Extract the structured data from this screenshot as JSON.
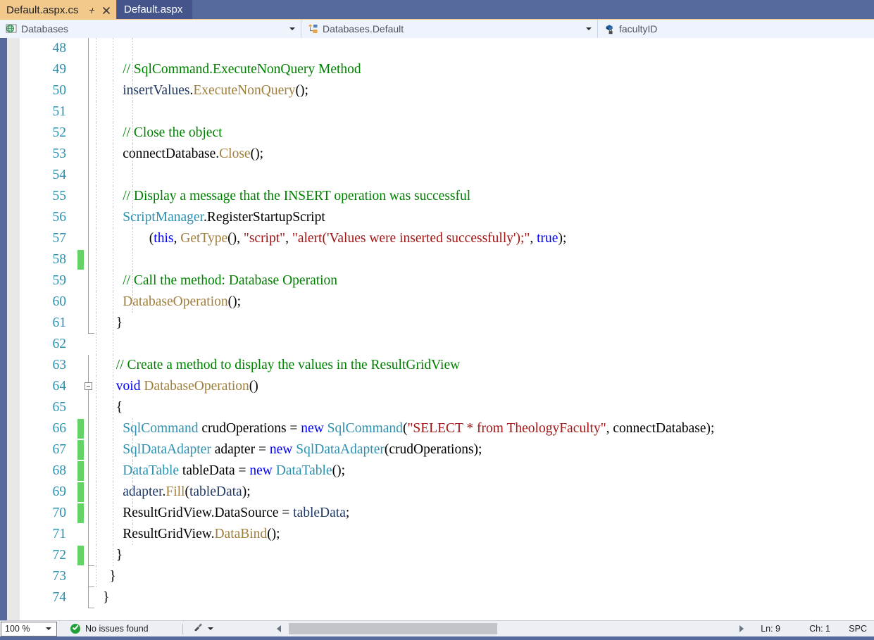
{
  "window": {
    "chrome_color": "#56699c",
    "editor_background": "#ffffff"
  },
  "tabs": [
    {
      "label": "Default.aspx.cs",
      "active": true,
      "pin_icon": "pin-icon",
      "close_icon": "close-icon"
    },
    {
      "label": "Default.aspx",
      "active": false
    }
  ],
  "navbar": {
    "project_dropdown": {
      "icon": "web-page-icon",
      "value": "Databases"
    },
    "type_dropdown": {
      "icon": "class-icon",
      "value": "Databases.Default"
    },
    "member_dropdown": {
      "icon": "private-field-icon",
      "value": "facultyID"
    }
  },
  "editor": {
    "first_line": 48,
    "lines": [
      {
        "n": 48,
        "indent": 0,
        "changed": false,
        "tokens": []
      },
      {
        "n": 49,
        "indent": 3,
        "changed": false,
        "tokens": [
          {
            "t": "// SqlCommand.ExecuteNonQuery Method",
            "c": "t-cmt"
          }
        ]
      },
      {
        "n": 50,
        "indent": 3,
        "changed": false,
        "tokens": [
          {
            "t": "insertValues",
            "c": "t-var"
          },
          {
            "t": ".",
            "c": "t-pln"
          },
          {
            "t": "ExecuteNonQuery",
            "c": "t-mth"
          },
          {
            "t": "();",
            "c": "t-pln"
          }
        ]
      },
      {
        "n": 51,
        "indent": 0,
        "changed": false,
        "tokens": []
      },
      {
        "n": 52,
        "indent": 3,
        "changed": false,
        "tokens": [
          {
            "t": "// Close the object",
            "c": "t-cmt"
          }
        ]
      },
      {
        "n": 53,
        "indent": 3,
        "changed": false,
        "tokens": [
          {
            "t": "connectDatabase",
            "c": "t-pln"
          },
          {
            "t": ".",
            "c": "t-pln"
          },
          {
            "t": "Close",
            "c": "t-mth"
          },
          {
            "t": "();",
            "c": "t-pln"
          }
        ]
      },
      {
        "n": 54,
        "indent": 0,
        "changed": false,
        "tokens": []
      },
      {
        "n": 55,
        "indent": 3,
        "changed": false,
        "tokens": [
          {
            "t": "// Display a message that the INSERT operation was successful",
            "c": "t-cmt"
          }
        ]
      },
      {
        "n": 56,
        "indent": 3,
        "changed": false,
        "tokens": [
          {
            "t": "ScriptManager",
            "c": "t-typ"
          },
          {
            "t": ".RegisterStartupScript",
            "c": "t-pln"
          }
        ]
      },
      {
        "n": 57,
        "indent": 7,
        "changed": false,
        "tokens": [
          {
            "t": "(",
            "c": "t-pln"
          },
          {
            "t": "this",
            "c": "t-kw"
          },
          {
            "t": ", ",
            "c": "t-pln"
          },
          {
            "t": "GetType",
            "c": "t-mth"
          },
          {
            "t": "(), ",
            "c": "t-pln"
          },
          {
            "t": "\"script\"",
            "c": "t-str"
          },
          {
            "t": ", ",
            "c": "t-pln"
          },
          {
            "t": "\"alert('Values were inserted successfully');\"",
            "c": "t-str"
          },
          {
            "t": ", ",
            "c": "t-pln"
          },
          {
            "t": "true",
            "c": "t-kw"
          },
          {
            "t": ");",
            "c": "t-pln"
          }
        ]
      },
      {
        "n": 58,
        "indent": 0,
        "changed": true,
        "tokens": []
      },
      {
        "n": 59,
        "indent": 3,
        "changed": false,
        "tokens": [
          {
            "t": "// Call the method: Database Operation",
            "c": "t-cmt"
          }
        ]
      },
      {
        "n": 60,
        "indent": 3,
        "changed": false,
        "tokens": [
          {
            "t": "DatabaseOperation",
            "c": "t-mth"
          },
          {
            "t": "();",
            "c": "t-pln"
          }
        ]
      },
      {
        "n": 61,
        "indent": 2,
        "changed": false,
        "tokens": [
          {
            "t": "}",
            "c": "t-pln"
          }
        ]
      },
      {
        "n": 62,
        "indent": 0,
        "changed": false,
        "tokens": []
      },
      {
        "n": 63,
        "indent": 2,
        "changed": false,
        "tokens": [
          {
            "t": "// Create a method to display the values in the ResultGridView",
            "c": "t-cmt"
          }
        ]
      },
      {
        "n": 64,
        "indent": 2,
        "changed": false,
        "outline": "collapse",
        "tokens": [
          {
            "t": "void",
            "c": "t-kw"
          },
          {
            "t": " ",
            "c": "t-pln"
          },
          {
            "t": "DatabaseOperation",
            "c": "t-mth"
          },
          {
            "t": "()",
            "c": "t-pln"
          }
        ]
      },
      {
        "n": 65,
        "indent": 2,
        "changed": false,
        "tokens": [
          {
            "t": "{",
            "c": "t-pln"
          }
        ]
      },
      {
        "n": 66,
        "indent": 3,
        "changed": true,
        "tokens": [
          {
            "t": "SqlCommand",
            "c": "t-typ"
          },
          {
            "t": " crudOperations ",
            "c": "t-pln"
          },
          {
            "t": "= ",
            "c": "t-pln"
          },
          {
            "t": "new",
            "c": "t-kw"
          },
          {
            "t": " ",
            "c": "t-pln"
          },
          {
            "t": "SqlCommand",
            "c": "t-typ"
          },
          {
            "t": "(",
            "c": "t-pln"
          },
          {
            "t": "\"SELECT * from TheologyFaculty\"",
            "c": "t-str"
          },
          {
            "t": ", connectDatabase);",
            "c": "t-pln"
          }
        ]
      },
      {
        "n": 67,
        "indent": 3,
        "changed": true,
        "tokens": [
          {
            "t": "SqlDataAdapter",
            "c": "t-typ"
          },
          {
            "t": " adapter ",
            "c": "t-pln"
          },
          {
            "t": "= ",
            "c": "t-pln"
          },
          {
            "t": "new",
            "c": "t-kw"
          },
          {
            "t": " ",
            "c": "t-pln"
          },
          {
            "t": "SqlDataAdapter",
            "c": "t-typ"
          },
          {
            "t": "(crudOperations);",
            "c": "t-pln"
          }
        ]
      },
      {
        "n": 68,
        "indent": 3,
        "changed": true,
        "tokens": [
          {
            "t": "DataTable",
            "c": "t-typ"
          },
          {
            "t": " tableData ",
            "c": "t-pln"
          },
          {
            "t": "= ",
            "c": "t-pln"
          },
          {
            "t": "new",
            "c": "t-kw"
          },
          {
            "t": " ",
            "c": "t-pln"
          },
          {
            "t": "DataTable",
            "c": "t-typ"
          },
          {
            "t": "();",
            "c": "t-pln"
          }
        ]
      },
      {
        "n": 69,
        "indent": 3,
        "changed": true,
        "tokens": [
          {
            "t": "adapter",
            "c": "t-var"
          },
          {
            "t": ".",
            "c": "t-pln"
          },
          {
            "t": "Fill",
            "c": "t-mth"
          },
          {
            "t": "(",
            "c": "t-pln"
          },
          {
            "t": "tableData",
            "c": "t-var"
          },
          {
            "t": ");",
            "c": "t-pln"
          }
        ]
      },
      {
        "n": 70,
        "indent": 3,
        "changed": true,
        "tokens": [
          {
            "t": "ResultGridView.DataSource ",
            "c": "t-pln"
          },
          {
            "t": "= ",
            "c": "t-pln"
          },
          {
            "t": "tableData",
            "c": "t-var"
          },
          {
            "t": ";",
            "c": "t-pln"
          }
        ]
      },
      {
        "n": 71,
        "indent": 3,
        "changed": false,
        "tokens": [
          {
            "t": "ResultGridView.",
            "c": "t-pln"
          },
          {
            "t": "DataBind",
            "c": "t-mth"
          },
          {
            "t": "();",
            "c": "t-pln"
          }
        ]
      },
      {
        "n": 72,
        "indent": 2,
        "changed": true,
        "tokens": [
          {
            "t": "}",
            "c": "t-pln"
          }
        ]
      },
      {
        "n": 73,
        "indent": 1,
        "changed": false,
        "tokens": [
          {
            "t": "}",
            "c": "t-pln"
          }
        ]
      },
      {
        "n": 74,
        "indent": 0,
        "changed": false,
        "tokens": [
          {
            "t": "}",
            "c": "t-pln"
          }
        ]
      }
    ]
  },
  "statusbar": {
    "zoom": "100 %",
    "issues_icon": "success-check-icon",
    "issues_text": "No issues found",
    "brush_icon": "brush-icon",
    "scroll_left_icon": "scroll-left-arrow-icon",
    "scroll_right_icon": "scroll-right-arrow-icon",
    "line_indicator": "Ln: 9",
    "column_indicator": "Ch: 1",
    "spacing_indicator": "SPC"
  }
}
